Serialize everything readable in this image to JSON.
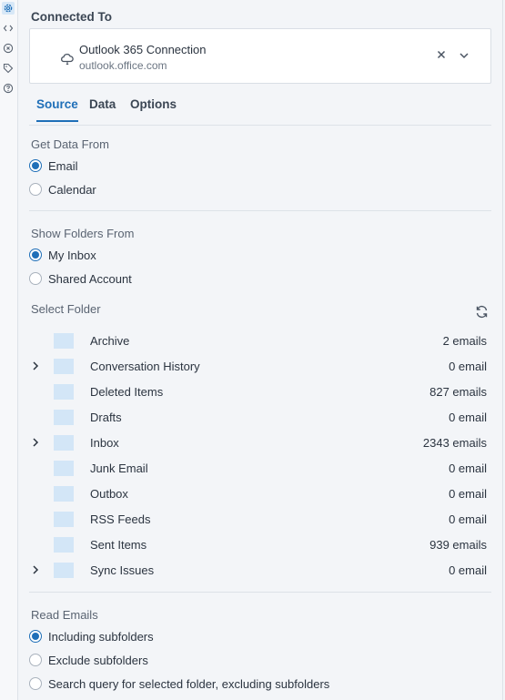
{
  "rail": {
    "icons": [
      "gear-icon",
      "code-icon",
      "plug-icon",
      "tag-icon",
      "help-icon"
    ]
  },
  "connection": {
    "section_title": "Connected To",
    "name": "Outlook 365 Connection",
    "host": "outlook.office.com"
  },
  "tabs": [
    {
      "label": "Source",
      "active": true
    },
    {
      "label": "Data",
      "active": false
    },
    {
      "label": "Options",
      "active": false
    }
  ],
  "get_data_from": {
    "title": "Get Data From",
    "options": [
      {
        "label": "Email",
        "checked": true
      },
      {
        "label": "Calendar",
        "checked": false
      }
    ]
  },
  "show_folders_from": {
    "title": "Show Folders From",
    "options": [
      {
        "label": "My Inbox",
        "checked": true
      },
      {
        "label": "Shared Account",
        "checked": false
      }
    ]
  },
  "select_folder": {
    "title": "Select Folder",
    "folders": [
      {
        "name": "Archive",
        "count": "2 emails",
        "expandable": false
      },
      {
        "name": "Conversation History",
        "count": "0 email",
        "expandable": true
      },
      {
        "name": "Deleted Items",
        "count": "827 emails",
        "expandable": false
      },
      {
        "name": "Drafts",
        "count": "0 email",
        "expandable": false
      },
      {
        "name": "Inbox",
        "count": "2343 emails",
        "expandable": true
      },
      {
        "name": "Junk Email",
        "count": "0 email",
        "expandable": false
      },
      {
        "name": "Outbox",
        "count": "0 email",
        "expandable": false
      },
      {
        "name": "RSS Feeds",
        "count": "0 email",
        "expandable": false
      },
      {
        "name": "Sent Items",
        "count": "939 emails",
        "expandable": false
      },
      {
        "name": "Sync Issues",
        "count": "0 email",
        "expandable": true
      }
    ]
  },
  "read_emails": {
    "title": "Read Emails",
    "options": [
      {
        "label": "Including subfolders",
        "checked": true
      },
      {
        "label": "Exclude subfolders",
        "checked": false
      },
      {
        "label": "Search query for selected folder, excluding subfolders",
        "checked": false
      }
    ]
  },
  "colors": {
    "accent": "#1f6fb8",
    "folder": "#d3e6f7",
    "background": "#f3f5f8"
  }
}
